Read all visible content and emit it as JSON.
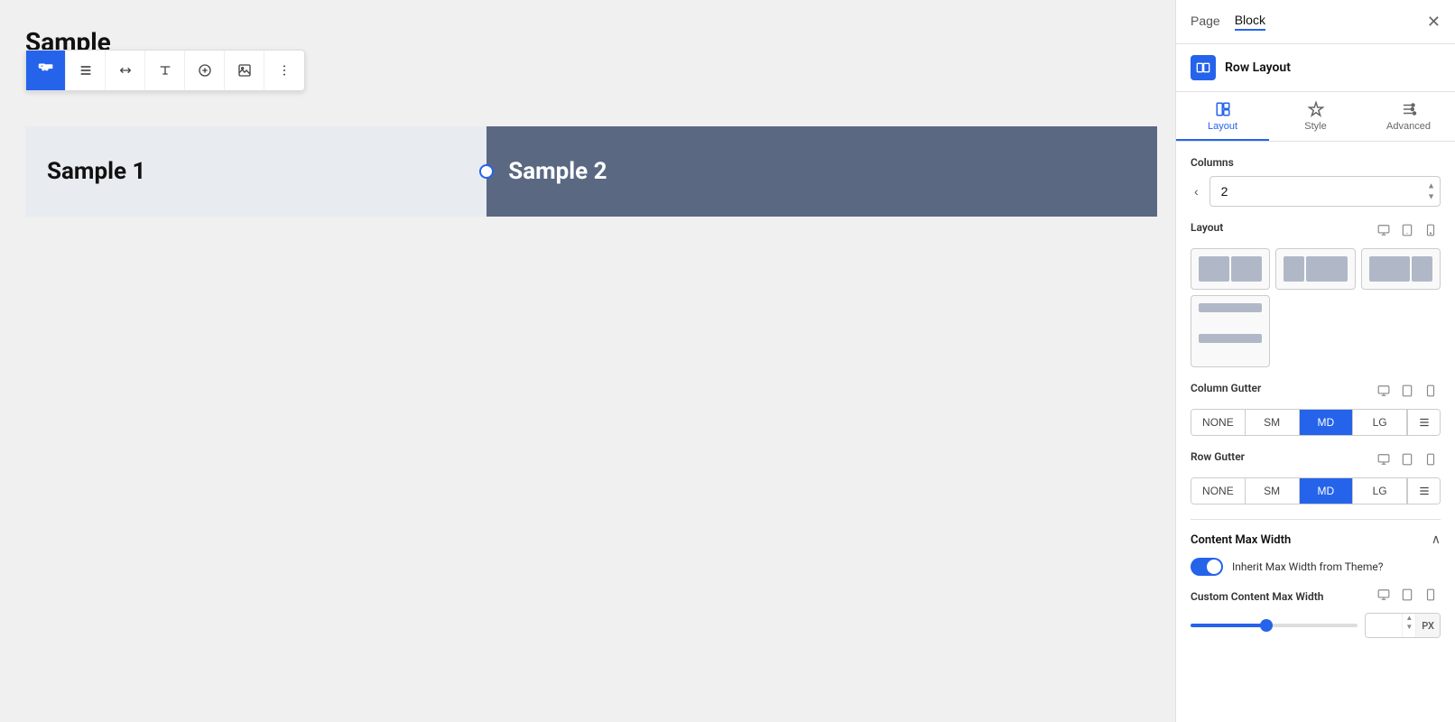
{
  "canvas": {
    "sample_title": "Sample",
    "block1_label": "Sample 1",
    "block2_label": "Sample 2"
  },
  "toolbar": {
    "buttons": [
      {
        "icon": "🚛",
        "name": "move-icon",
        "active": true
      },
      {
        "icon": "≡",
        "name": "list-icon",
        "active": false
      },
      {
        "icon": "↔",
        "name": "resize-icon",
        "active": false
      },
      {
        "icon": "T",
        "name": "text-icon",
        "active": false
      },
      {
        "icon": "+",
        "name": "add-icon",
        "active": false
      },
      {
        "icon": "⊡",
        "name": "image-icon",
        "active": false
      },
      {
        "icon": "⋮",
        "name": "more-icon",
        "active": false
      }
    ]
  },
  "sidebar": {
    "tabs": [
      {
        "label": "Page",
        "active": false
      },
      {
        "label": "Block",
        "active": true
      }
    ],
    "close_label": "✕",
    "block_title": "Row Layout",
    "sub_tabs": [
      {
        "label": "Layout",
        "active": true,
        "icon": "layout"
      },
      {
        "label": "Style",
        "active": false,
        "icon": "style"
      },
      {
        "label": "Advanced",
        "active": false,
        "icon": "advanced"
      }
    ],
    "columns_label": "Columns",
    "columns_value": "2",
    "layout_label": "Layout",
    "layout_options": [
      {
        "cols": [
          1,
          1
        ],
        "id": "equal-2"
      },
      {
        "cols": [
          1,
          2
        ],
        "id": "left-heavy"
      },
      {
        "cols": [
          2,
          1
        ],
        "id": "right-heavy"
      },
      {
        "cols": [
          1
        ],
        "id": "full",
        "wide": true
      }
    ],
    "column_gutter_label": "Column Gutter",
    "gutter_options": [
      "NONE",
      "SM",
      "MD",
      "LG"
    ],
    "column_gutter_active": "MD",
    "row_gutter_label": "Row Gutter",
    "row_gutter_active": "MD",
    "content_max_width_label": "Content Max Width",
    "inherit_label": "Inherit Max Width from Theme?",
    "toggle_on": true,
    "custom_width_label": "Custom Content Max Width",
    "custom_width_value": "",
    "custom_width_unit": "PX",
    "slider_value": 45
  }
}
